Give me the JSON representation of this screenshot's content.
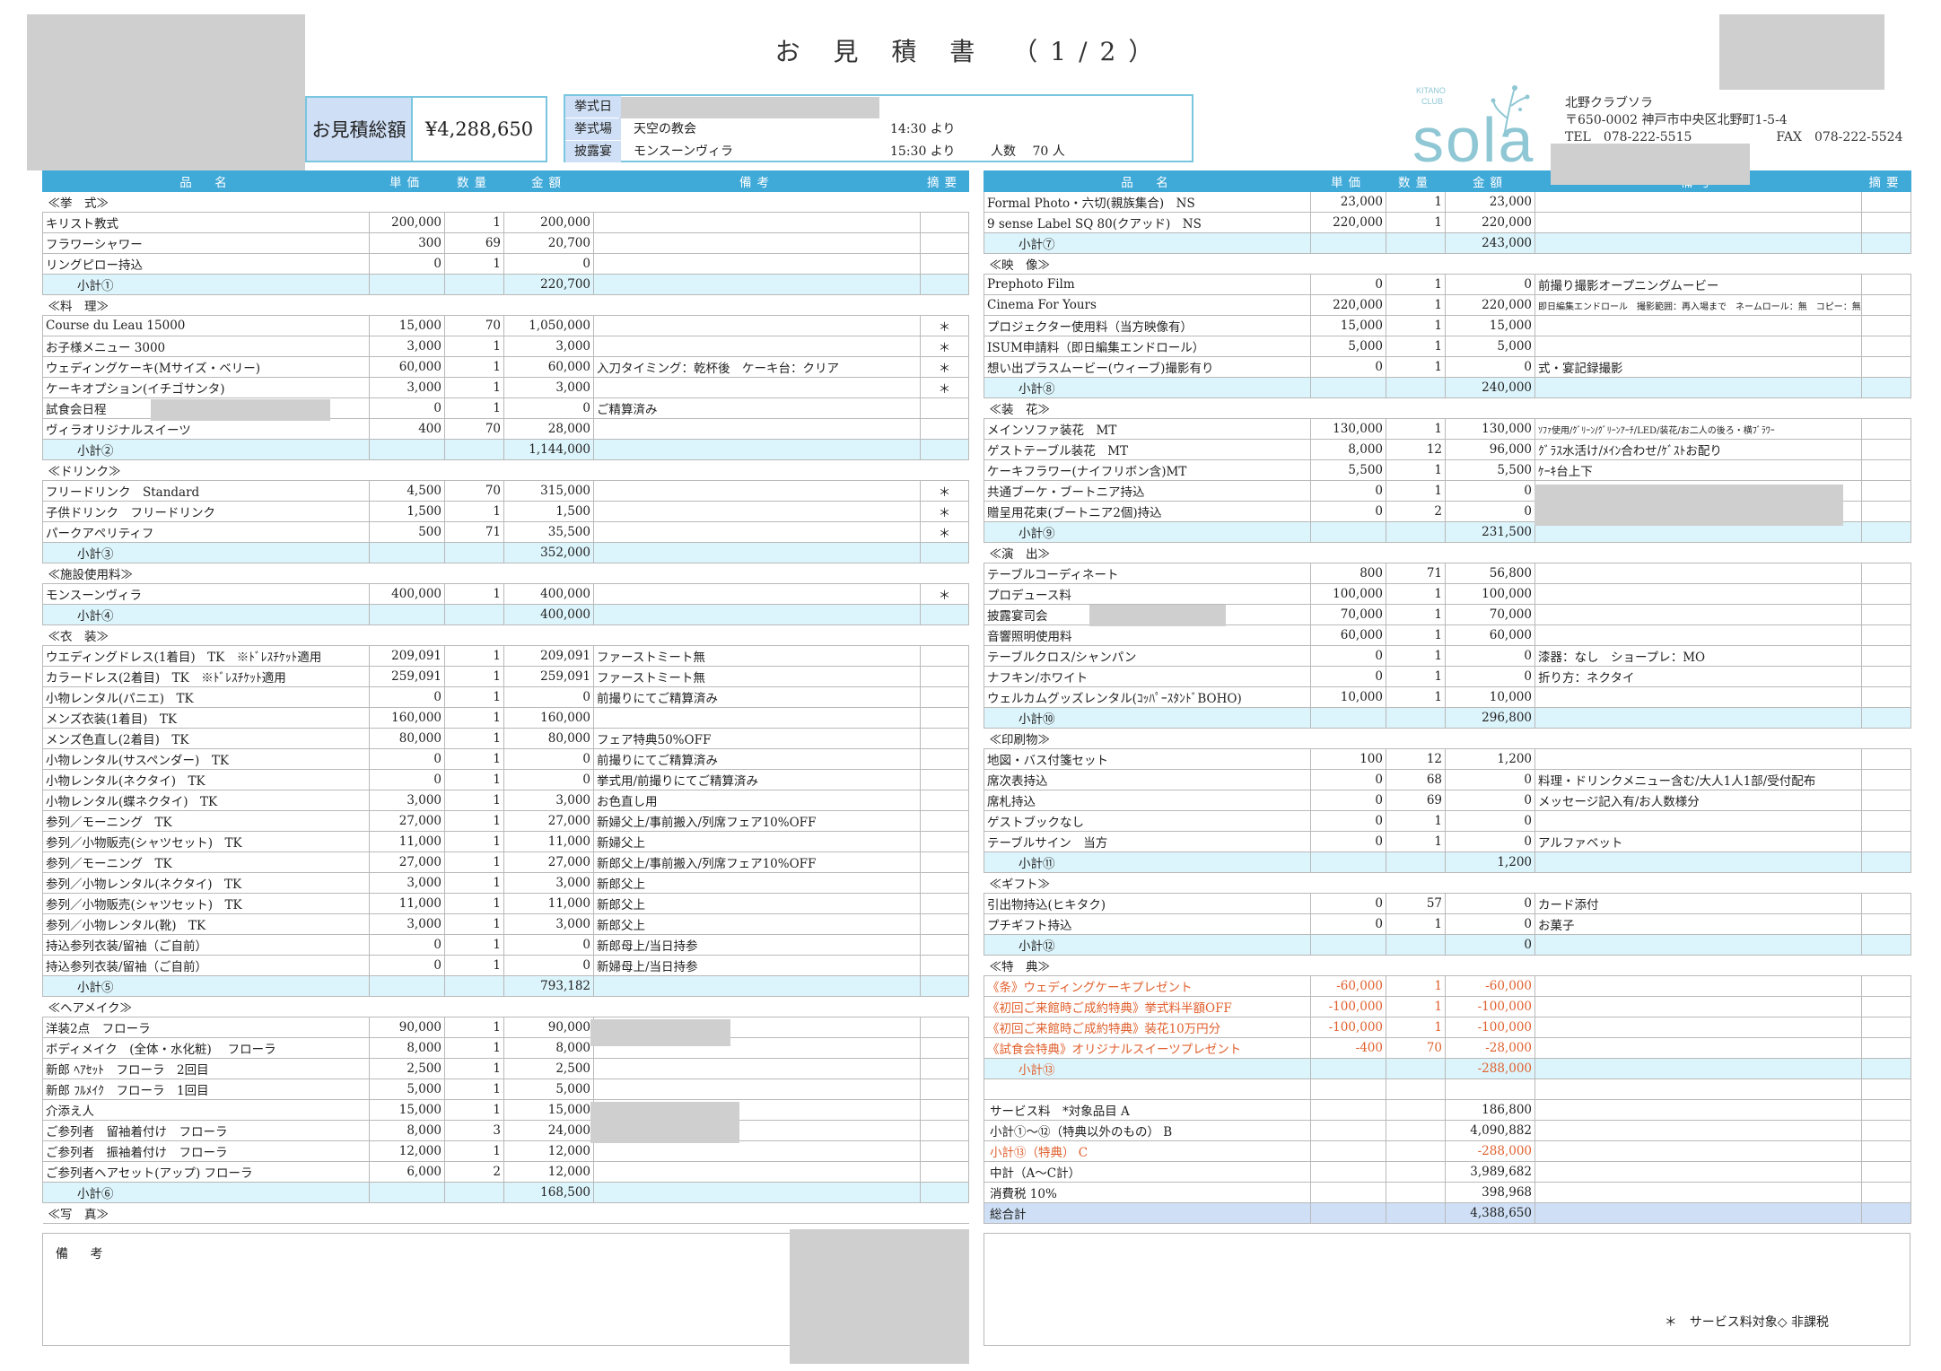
{
  "header": {
    "title": "お 見 積 書　（1/2）",
    "total_label": "お見積総額",
    "total_value": "¥4,288,650",
    "event": [
      {
        "label": "挙式日",
        "text": "",
        "time": ""
      },
      {
        "label": "挙式場",
        "text": "天空の教会",
        "time": "14:30 より",
        "extra": ""
      },
      {
        "label": "披露宴",
        "text": "モンスーンヴィラ",
        "time": "15:30 より",
        "extra": "人数　 70 人"
      }
    ],
    "logo": {
      "line1": "KITANO",
      "line2": "CLUB",
      "word": "sola"
    },
    "company": {
      "name": "北野クラブソラ",
      "address": "〒650-0002 神戸市中央区北野町1-5-4",
      "tel": "TEL　078-222-5515",
      "fax": "FAX　078-222-5524"
    }
  },
  "columns": [
    "品　名",
    "単価",
    "数量",
    "金額",
    "備考",
    "摘要"
  ],
  "left_rows": [
    {
      "t": "sec",
      "name": "≪挙　式≫"
    },
    {
      "name": "キリスト教式",
      "price": "200,000",
      "qty": "1",
      "amount": "200,000",
      "note": "",
      "mark": ""
    },
    {
      "name": "フラワーシャワー",
      "price": "300",
      "qty": "69",
      "amount": "20,700",
      "note": "",
      "mark": ""
    },
    {
      "name": "リングピロー持込",
      "price": "0",
      "qty": "1",
      "amount": "0",
      "note": "",
      "mark": ""
    },
    {
      "t": "sub",
      "name": "小計①",
      "amount": "220,700"
    },
    {
      "t": "sec",
      "name": "≪料　理≫"
    },
    {
      "name": "Course du Leau 15000",
      "price": "15,000",
      "qty": "70",
      "amount": "1,050,000",
      "note": "",
      "mark": "＊"
    },
    {
      "name": "お子様メニュー 3000",
      "price": "3,000",
      "qty": "1",
      "amount": "3,000",
      "note": "",
      "mark": "＊"
    },
    {
      "name": "ウェディングケーキ(Mサイズ・ベリー)",
      "price": "60,000",
      "qty": "1",
      "amount": "60,000",
      "note": "入刀タイミング：乾杯後　ケーキ台：クリア",
      "mark": "＊"
    },
    {
      "name": "ケーキオプション(イチゴサンタ)",
      "price": "3,000",
      "qty": "1",
      "amount": "3,000",
      "note": "",
      "mark": "＊"
    },
    {
      "name": "試食会日程",
      "price": "0",
      "qty": "1",
      "amount": "0",
      "note": "ご精算済み",
      "mark": ""
    },
    {
      "name": "ヴィラオリジナルスイーツ",
      "price": "400",
      "qty": "70",
      "amount": "28,000",
      "note": "",
      "mark": ""
    },
    {
      "t": "sub",
      "name": "小計②",
      "amount": "1,144,000"
    },
    {
      "t": "sec",
      "name": "≪ドリンク≫"
    },
    {
      "name": "フリードリンク　Standard",
      "price": "4,500",
      "qty": "70",
      "amount": "315,000",
      "note": "",
      "mark": "＊"
    },
    {
      "name": "子供ドリンク　フリードリンク",
      "price": "1,500",
      "qty": "1",
      "amount": "1,500",
      "note": "",
      "mark": "＊"
    },
    {
      "name": "パークアペリティフ",
      "price": "500",
      "qty": "71",
      "amount": "35,500",
      "note": "",
      "mark": "＊"
    },
    {
      "t": "sub",
      "name": "小計③",
      "amount": "352,000"
    },
    {
      "t": "sec",
      "name": "≪施設使用料≫"
    },
    {
      "name": "モンスーンヴィラ",
      "price": "400,000",
      "qty": "1",
      "amount": "400,000",
      "note": "",
      "mark": "＊"
    },
    {
      "t": "sub",
      "name": "小計④",
      "amount": "400,000"
    },
    {
      "t": "sec",
      "name": "≪衣　装≫"
    },
    {
      "name": "ウエディングドレス(1着目)　TK　※ﾄﾞﾚｽﾁｹｯﾄ適用",
      "price": "209,091",
      "qty": "1",
      "amount": "209,091",
      "note": "ファーストミート無",
      "mark": ""
    },
    {
      "name": "カラードレス(2着目)　TK　※ﾄﾞﾚｽﾁｹｯﾄ適用",
      "price": "259,091",
      "qty": "1",
      "amount": "259,091",
      "note": "ファーストミート無",
      "mark": ""
    },
    {
      "name": "小物レンタル(パニエ)　TK",
      "price": "0",
      "qty": "1",
      "amount": "0",
      "note": "前撮りにてご精算済み",
      "mark": ""
    },
    {
      "name": "メンズ衣装(1着目)　TK",
      "price": "160,000",
      "qty": "1",
      "amount": "160,000",
      "note": "",
      "mark": ""
    },
    {
      "name": "メンズ色直し(2着目)　TK",
      "price": "80,000",
      "qty": "1",
      "amount": "80,000",
      "note": "フェア特典50%OFF",
      "mark": ""
    },
    {
      "name": "小物レンタル(サスペンダー)　TK",
      "price": "0",
      "qty": "1",
      "amount": "0",
      "note": "前撮りにてご精算済み",
      "mark": ""
    },
    {
      "name": "小物レンタル(ネクタイ)　TK",
      "price": "0",
      "qty": "1",
      "amount": "0",
      "note": "挙式用/前撮りにてご精算済み",
      "mark": ""
    },
    {
      "name": "小物レンタル(蝶ネクタイ)　TK",
      "price": "3,000",
      "qty": "1",
      "amount": "3,000",
      "note": "お色直し用",
      "mark": ""
    },
    {
      "name": "参列／モーニング　TK",
      "price": "27,000",
      "qty": "1",
      "amount": "27,000",
      "note": "新婦父上/事前搬入/列席フェア10%OFF",
      "mark": ""
    },
    {
      "name": "参列／小物販売(シャツセット)　TK",
      "price": "11,000",
      "qty": "1",
      "amount": "11,000",
      "note": "新婦父上",
      "mark": ""
    },
    {
      "name": "参列／モーニング　TK",
      "price": "27,000",
      "qty": "1",
      "amount": "27,000",
      "note": "新郎父上/事前搬入/列席フェア10%OFF",
      "mark": ""
    },
    {
      "name": "参列／小物レンタル(ネクタイ)　TK",
      "price": "3,000",
      "qty": "1",
      "amount": "3,000",
      "note": "新郎父上",
      "mark": ""
    },
    {
      "name": "参列／小物販売(シャツセット)　TK",
      "price": "11,000",
      "qty": "1",
      "amount": "11,000",
      "note": "新郎父上",
      "mark": ""
    },
    {
      "name": "参列／小物レンタル(靴)　TK",
      "price": "3,000",
      "qty": "1",
      "amount": "3,000",
      "note": "新郎父上",
      "mark": ""
    },
    {
      "name": "持込参列衣装/留袖（ご自前）",
      "price": "0",
      "qty": "1",
      "amount": "0",
      "note": "新郎母上/当日持参",
      "mark": ""
    },
    {
      "name": "持込参列衣装/留袖（ご自前）",
      "price": "0",
      "qty": "1",
      "amount": "0",
      "note": "新婦母上/当日持参",
      "mark": ""
    },
    {
      "t": "sub",
      "name": "小計⑤",
      "amount": "793,182"
    },
    {
      "t": "sec",
      "name": "≪ヘアメイク≫"
    },
    {
      "name": "洋装2点　フローラ",
      "price": "90,000",
      "qty": "1",
      "amount": "90,000",
      "note": "",
      "mark": ""
    },
    {
      "name": "ボディメイク　(全体・水化粧)　 フローラ",
      "price": "8,000",
      "qty": "1",
      "amount": "8,000",
      "note": "",
      "mark": ""
    },
    {
      "name": "新郎 ﾍｱｾｯﾄ　フローラ　2回目",
      "price": "2,500",
      "qty": "1",
      "amount": "2,500",
      "note": "",
      "mark": ""
    },
    {
      "name": "新郎 ﾌﾙﾒｲｸ　フローラ　1回目",
      "price": "5,000",
      "qty": "1",
      "amount": "5,000",
      "note": "",
      "mark": ""
    },
    {
      "name": "介添え人",
      "price": "15,000",
      "qty": "1",
      "amount": "15,000",
      "note": "",
      "mark": ""
    },
    {
      "name": "ご参列者　留袖着付け　フローラ",
      "price": "8,000",
      "qty": "3",
      "amount": "24,000",
      "note": "",
      "mark": ""
    },
    {
      "name": "ご参列者　振袖着付け　フローラ",
      "price": "12,000",
      "qty": "1",
      "amount": "12,000",
      "note": "",
      "mark": ""
    },
    {
      "name": "ご参列者ヘアセット(アップ) フローラ",
      "price": "6,000",
      "qty": "2",
      "amount": "12,000",
      "note": "",
      "mark": ""
    },
    {
      "t": "sub",
      "name": "小計⑥",
      "amount": "168,500"
    },
    {
      "t": "sec",
      "name": "≪写　真≫"
    }
  ],
  "right_rows": [
    {
      "name": "Formal Photo・六切(親族集合)　NS",
      "price": "23,000",
      "qty": "1",
      "amount": "23,000",
      "note": "",
      "mark": ""
    },
    {
      "name": "9 sense Label SQ 80(クアッド)　NS",
      "price": "220,000",
      "qty": "1",
      "amount": "220,000",
      "note": "",
      "mark": ""
    },
    {
      "t": "sub",
      "name": "小計⑦",
      "amount": "243,000"
    },
    {
      "t": "sec",
      "name": "≪映　像≫"
    },
    {
      "name": "Prephoto Film",
      "price": "0",
      "qty": "1",
      "amount": "0",
      "note": "前撮り撮影オープニングムービー",
      "mark": ""
    },
    {
      "name": "Cinema For Yours",
      "price": "220,000",
      "qty": "1",
      "amount": "220,000",
      "note": "即日編集エンドロール　撮影範囲：再入場まで　ネームロール：無　コピー：無",
      "mark": "",
      "small": true
    },
    {
      "name": "プロジェクター使用料（当方映像有）",
      "price": "15,000",
      "qty": "1",
      "amount": "15,000",
      "note": "",
      "mark": ""
    },
    {
      "name": "ISUM申請料（即日編集エンドロール）",
      "price": "5,000",
      "qty": "1",
      "amount": "5,000",
      "note": "",
      "mark": ""
    },
    {
      "name": "想い出プラスムービー(ウィーブ)撮影有り",
      "price": "0",
      "qty": "1",
      "amount": "0",
      "note": "式・宴記録撮影",
      "mark": ""
    },
    {
      "t": "sub",
      "name": "小計⑧",
      "amount": "240,000"
    },
    {
      "t": "sec",
      "name": "≪装　花≫"
    },
    {
      "name": "メインソファ装花　MT",
      "price": "130,000",
      "qty": "1",
      "amount": "130,000",
      "note": "ｿﾌｧ使用/ｸﾞﾘｰﾝ/ｸﾞﾘｰﾝｱｰﾁ/LED/装花/お二人の後ろ・横ﾌﾞﾗﾜｰ",
      "mark": "",
      "small": true
    },
    {
      "name": "ゲストテーブル装花　MT",
      "price": "8,000",
      "qty": "12",
      "amount": "96,000",
      "note": "ｸﾞﾗｽ水活け/ﾒｲﾝ合わせ/ｹﾞｽﾄお配り",
      "mark": ""
    },
    {
      "name": "ケーキフラワー(ナイフリボン含)MT",
      "price": "5,500",
      "qty": "1",
      "amount": "5,500",
      "note": "ｹｰｷ台上下",
      "mark": ""
    },
    {
      "name": "共通ブーケ・ブートニア持込",
      "price": "0",
      "qty": "1",
      "amount": "0",
      "note": "",
      "mark": ""
    },
    {
      "name": "贈呈用花束(ブートニア2個)持込",
      "price": "0",
      "qty": "2",
      "amount": "0",
      "note": "",
      "mark": ""
    },
    {
      "t": "sub",
      "name": "小計⑨",
      "amount": "231,500"
    },
    {
      "t": "sec",
      "name": "≪演　出≫"
    },
    {
      "name": "テーブルコーディネート",
      "price": "800",
      "qty": "71",
      "amount": "56,800",
      "note": "",
      "mark": ""
    },
    {
      "name": "プロデュース料",
      "price": "100,000",
      "qty": "1",
      "amount": "100,000",
      "note": "",
      "mark": ""
    },
    {
      "name": "披露宴司会",
      "price": "70,000",
      "qty": "1",
      "amount": "70,000",
      "note": "",
      "mark": ""
    },
    {
      "name": "音響照明使用料",
      "price": "60,000",
      "qty": "1",
      "amount": "60,000",
      "note": "",
      "mark": ""
    },
    {
      "name": "テーブルクロス/シャンパン",
      "price": "0",
      "qty": "1",
      "amount": "0",
      "note": "漆器：なし　ショープレ：MO",
      "mark": ""
    },
    {
      "name": "ナフキン/ホワイト",
      "price": "0",
      "qty": "1",
      "amount": "0",
      "note": "折り方：ネクタイ",
      "mark": ""
    },
    {
      "name": "ウェルカムグッズレンタル(ｺｯﾊﾟｰｽﾀﾝﾄﾞBOHO)",
      "price": "10,000",
      "qty": "1",
      "amount": "10,000",
      "note": "",
      "mark": ""
    },
    {
      "t": "sub",
      "name": "小計⑩",
      "amount": "296,800"
    },
    {
      "t": "sec",
      "name": "≪印刷物≫"
    },
    {
      "name": "地図・バス付箋セット",
      "price": "100",
      "qty": "12",
      "amount": "1,200",
      "note": "",
      "mark": ""
    },
    {
      "name": "席次表持込",
      "price": "0",
      "qty": "68",
      "amount": "0",
      "note": "料理・ドリンクメニュー含む/大人1人1部/受付配布",
      "mark": ""
    },
    {
      "name": "席札持込",
      "price": "0",
      "qty": "69",
      "amount": "0",
      "note": "メッセージ記入有/お人数様分",
      "mark": ""
    },
    {
      "name": "ゲストブックなし",
      "price": "0",
      "qty": "1",
      "amount": "0",
      "note": "",
      "mark": ""
    },
    {
      "name": "テーブルサイン　当方",
      "price": "0",
      "qty": "1",
      "amount": "0",
      "note": "アルファベット",
      "mark": ""
    },
    {
      "t": "sub",
      "name": "小計⑪",
      "amount": "1,200"
    },
    {
      "t": "sec",
      "name": "≪ギフト≫"
    },
    {
      "name": "引出物持込(ヒキタク)",
      "price": "0",
      "qty": "57",
      "amount": "0",
      "note": "カード添付",
      "mark": ""
    },
    {
      "name": "プチギフト持込",
      "price": "0",
      "qty": "1",
      "amount": "0",
      "note": "お菓子",
      "mark": ""
    },
    {
      "t": "sub",
      "name": "小計⑫",
      "amount": "0"
    },
    {
      "t": "sec",
      "name": "≪特　典≫"
    },
    {
      "t": "red",
      "name": "《条》ウェディングケーキプレゼント",
      "price": "-60,000",
      "qty": "1",
      "amount": "-60,000",
      "note": "",
      "mark": ""
    },
    {
      "t": "red",
      "name": "《初回ご来館時ご成約特典》挙式料半額OFF",
      "price": "-100,000",
      "qty": "1",
      "amount": "-100,000",
      "note": "",
      "mark": ""
    },
    {
      "t": "red",
      "name": "《初回ご来館時ご成約特典》装花10万円分",
      "price": "-100,000",
      "qty": "1",
      "amount": "-100,000",
      "note": "",
      "mark": ""
    },
    {
      "t": "red",
      "name": "《試食会特典》オリジナルスイーツプレゼント",
      "price": "-400",
      "qty": "70",
      "amount": "-28,000",
      "note": "",
      "mark": ""
    },
    {
      "t": "subred",
      "name": "小計⑬",
      "amount": "-288,000"
    },
    {
      "t": "blank"
    },
    {
      "t": "smry",
      "name": "サービス料　*対象品目 A",
      "amount": "186,800"
    },
    {
      "t": "smry",
      "name": "小計①～⑫（特典以外のもの） B",
      "amount": "4,090,882"
    },
    {
      "t": "smryred",
      "name": "小計⑬（特典） C",
      "amount": "-288,000"
    },
    {
      "t": "smry",
      "name": "中計（A～C計）",
      "amount": "3,989,682"
    },
    {
      "t": "smry",
      "name": "消費税 10%",
      "amount": "398,968"
    },
    {
      "t": "grand",
      "name": "総合計",
      "amount": "4,388,650"
    }
  ],
  "notes": {
    "label": "備 考",
    "legend": "＊　サービス料対象◇ 非課税"
  },
  "colors": {
    "header_bg": "#3fa9d8",
    "subtotal_bg": "#dcf4fb",
    "label_bg": "#cfe0f6",
    "red_text": "#e0602e"
  }
}
